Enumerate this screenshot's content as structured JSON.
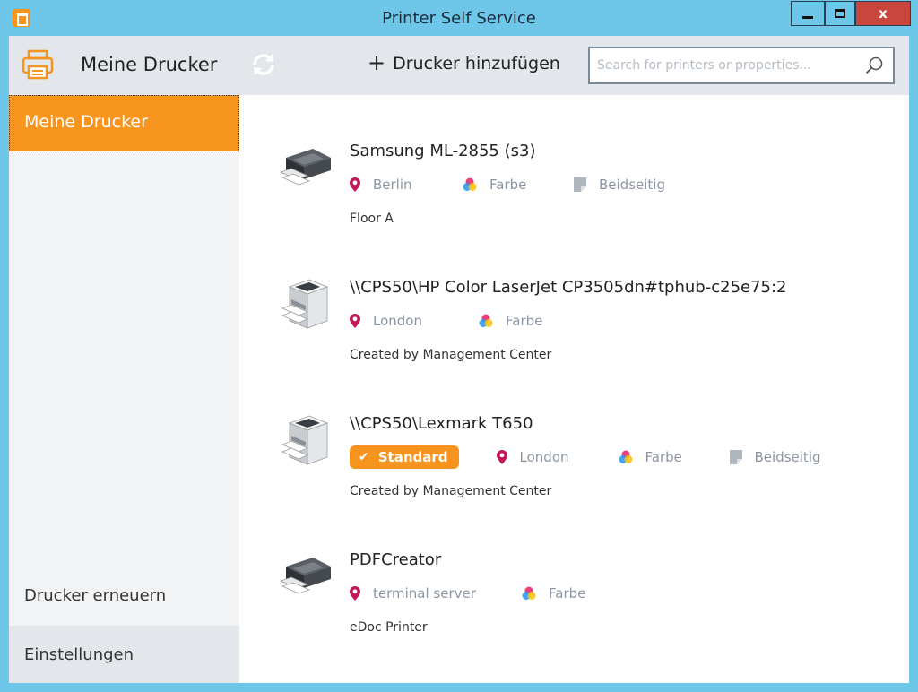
{
  "window": {
    "title": "Printer Self Service",
    "close_label": "x"
  },
  "header": {
    "title": "Meine Drucker",
    "add_label": "Drucker hinzufügen",
    "add_symbol": "+",
    "search_placeholder": "Search for printers or properties..."
  },
  "sidebar": {
    "active": "Meine Drucker",
    "renew": "Drucker erneuern",
    "settings": "Einstellungen"
  },
  "printers": [
    {
      "name": "Samsung ML-2855 (s3)",
      "location": "Berlin",
      "color": "Farbe",
      "duplex": "Beidseitig",
      "description": "Floor A"
    },
    {
      "name": "\\\\CPS50\\HP Color LaserJet CP3505dn#tphub-c25e75:2",
      "location": "London",
      "color": "Farbe",
      "description": "Created by Management Center"
    },
    {
      "name": "\\\\CPS50\\Lexmark T650",
      "badge": "Standard",
      "location": "London",
      "color": "Farbe",
      "duplex": "Beidseitig",
      "description": "Created by Management Center"
    },
    {
      "name": "PDFCreator",
      "location": "terminal server",
      "color": "Farbe",
      "description": "eDoc Printer"
    }
  ],
  "colors": {
    "accent": "#f7941d",
    "frame": "#6ec6e8",
    "close": "#c9463d",
    "pin": "#c2185b",
    "tag_text": "#8c96a3"
  },
  "icons": {
    "app": "printer-app-icon",
    "refresh": "refresh-icon",
    "search": "search-icon",
    "location": "location-pin-icon",
    "color": "color-palette-icon",
    "duplex": "duplex-page-icon",
    "check": "check-icon"
  }
}
